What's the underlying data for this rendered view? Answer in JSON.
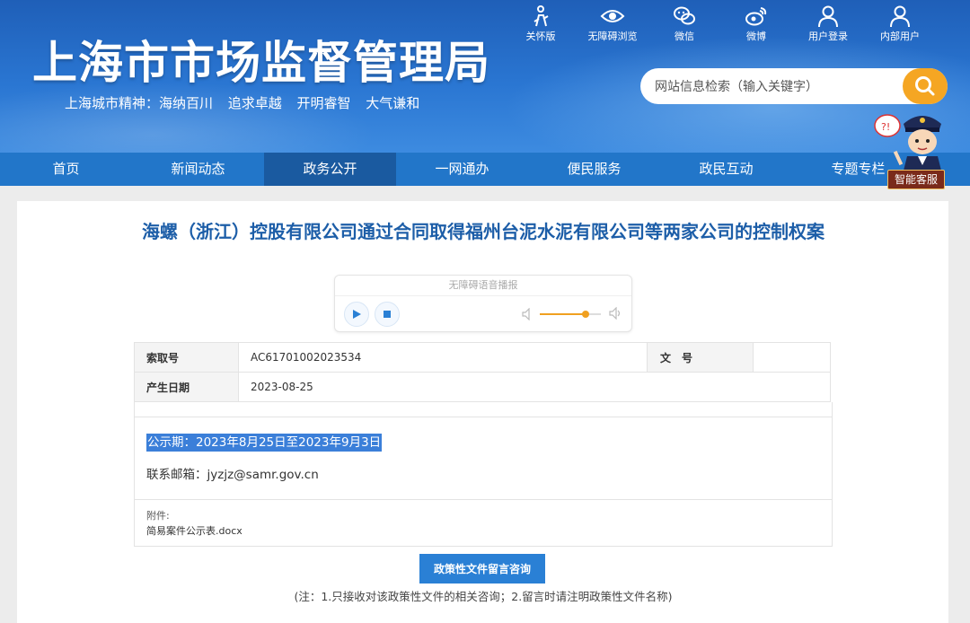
{
  "header": {
    "site_title": "上海市市场监督管理局",
    "slogan": "上海城市精神：海纳百川  追求卓越  开明睿智  大气谦和",
    "top_links": [
      {
        "label": "关怀版",
        "icon": "elder-care-icon"
      },
      {
        "label": "无障碍浏览",
        "icon": "eye-icon"
      },
      {
        "label": "微信",
        "icon": "wechat-icon"
      },
      {
        "label": "微博",
        "icon": "weibo-icon"
      },
      {
        "label": "用户登录",
        "icon": "user-icon"
      },
      {
        "label": "内部用户",
        "icon": "user-icon"
      }
    ],
    "search": {
      "placeholder": "网站信息检索（输入关键字）",
      "icon": "search-icon"
    }
  },
  "nav": {
    "items": [
      "首页",
      "新闻动态",
      "政务公开",
      "一网通办",
      "便民服务",
      "政民互动",
      "专题专栏"
    ],
    "active_index": 2
  },
  "assistant": {
    "label": "智能客服"
  },
  "article": {
    "title": "海螺（浙江）控股有限公司通过合同取得福州台泥水泥有限公司等两家公司的控制权案",
    "player": {
      "title": "无障碍语音播报",
      "volume": 0.75
    },
    "meta": {
      "index_label": "索取号",
      "index_value": "AC61701002023534",
      "doc_no_label": "文　号",
      "doc_no_value": "",
      "date_label": "产生日期",
      "date_value": "2023-08-25"
    },
    "notice_period": "公示期：2023年8月25日至2023年9月3日",
    "email": "联系邮箱：jyzjz@samr.gov.cn",
    "attachment_label": "附件:",
    "attachment_file": "简易案件公示表.docx",
    "consult_button": "政策性文件留言咨询",
    "footnote": "(注：1.只接收对该政策性文件的相关咨询；2.留言时请注明政策性文件名称)"
  },
  "colors": {
    "header_blue": "#2a76d2",
    "nav_blue": "#2276c9",
    "nav_active": "#1a5aa0",
    "title_blue": "#1d5ea8",
    "search_orange": "#f5a623"
  }
}
